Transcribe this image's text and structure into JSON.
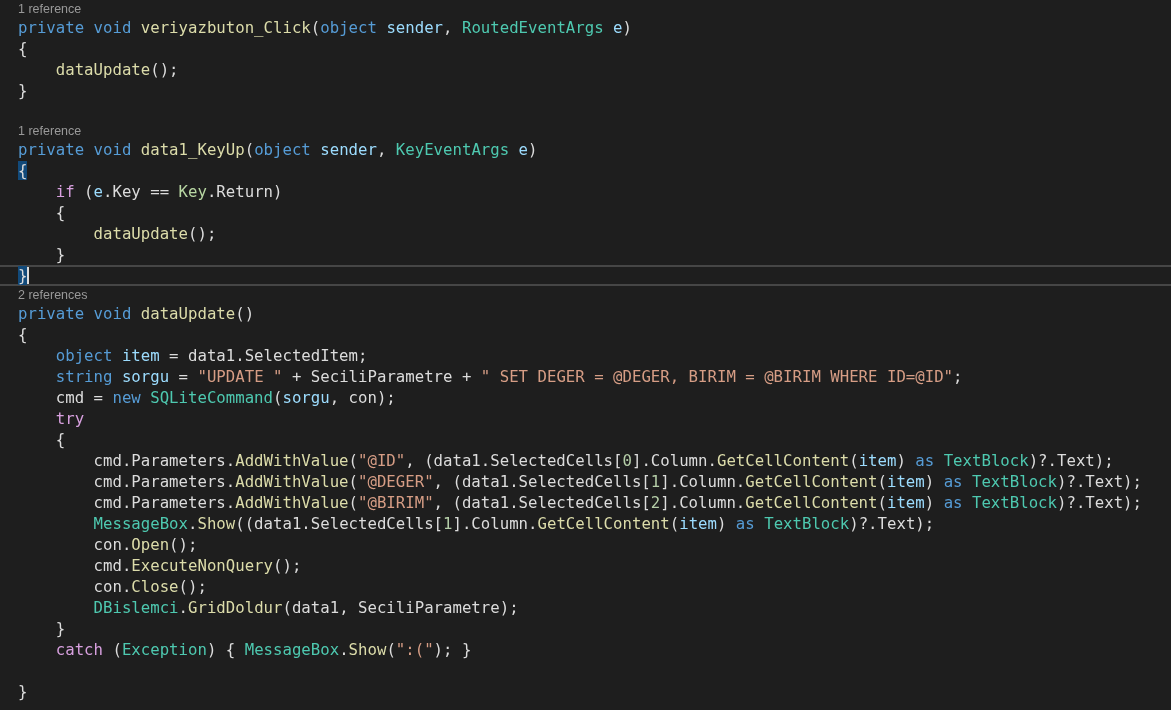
{
  "editor": {
    "lines": [
      {
        "kind": "lens",
        "text": "1 reference"
      },
      {
        "kind": "code",
        "tokens": [
          {
            "text": "private void ",
            "kind": "keyword"
          },
          {
            "text": "veriyazbuton_Click",
            "kind": "method"
          },
          {
            "text": "(",
            "kind": "plain"
          },
          {
            "text": "object ",
            "kind": "keyword"
          },
          {
            "text": "sender",
            "kind": "variable"
          },
          {
            "text": ", ",
            "kind": "plain"
          },
          {
            "text": "RoutedEventArgs ",
            "kind": "type"
          },
          {
            "text": "e",
            "kind": "variable"
          },
          {
            "text": ")",
            "kind": "plain"
          }
        ]
      },
      {
        "kind": "code",
        "tokens": [
          {
            "text": "{",
            "kind": "plain"
          }
        ]
      },
      {
        "kind": "code",
        "tokens": [
          {
            "text": "    dataUpdate",
            "kind": "method"
          },
          {
            "text": "();",
            "kind": "plain"
          }
        ]
      },
      {
        "kind": "code",
        "tokens": [
          {
            "text": "}",
            "kind": "plain"
          }
        ]
      },
      {
        "kind": "blank"
      },
      {
        "kind": "lens",
        "text": "1 reference"
      },
      {
        "kind": "code",
        "tokens": [
          {
            "text": "private void ",
            "kind": "keyword"
          },
          {
            "text": "data1_KeyUp",
            "kind": "method"
          },
          {
            "text": "(",
            "kind": "plain"
          },
          {
            "text": "object ",
            "kind": "keyword"
          },
          {
            "text": "sender",
            "kind": "variable"
          },
          {
            "text": ", ",
            "kind": "plain"
          },
          {
            "text": "KeyEventArgs ",
            "kind": "type"
          },
          {
            "text": "e",
            "kind": "variable"
          },
          {
            "text": ")",
            "kind": "plain"
          }
        ]
      },
      {
        "kind": "code",
        "tokens": [
          {
            "text": "{",
            "kind": "match"
          }
        ]
      },
      {
        "kind": "code",
        "tokens": [
          {
            "text": "    if",
            "kind": "control"
          },
          {
            "text": " (",
            "kind": "plain"
          },
          {
            "text": "e",
            "kind": "variable"
          },
          {
            "text": ".Key == ",
            "kind": "plain"
          },
          {
            "text": "Key",
            "kind": "enum"
          },
          {
            "text": ".Return)",
            "kind": "plain"
          }
        ]
      },
      {
        "kind": "code",
        "tokens": [
          {
            "text": "    {",
            "kind": "plain"
          }
        ]
      },
      {
        "kind": "code",
        "tokens": [
          {
            "text": "        dataUpdate",
            "kind": "method"
          },
          {
            "text": "();",
            "kind": "plain"
          }
        ]
      },
      {
        "kind": "code",
        "tokens": [
          {
            "text": "    }",
            "kind": "plain"
          }
        ]
      },
      {
        "kind": "current",
        "tokens": [
          {
            "text": "}",
            "kind": "match"
          }
        ]
      },
      {
        "kind": "lens",
        "text": "2 references"
      },
      {
        "kind": "code",
        "tokens": [
          {
            "text": "private void ",
            "kind": "keyword"
          },
          {
            "text": "dataUpdate",
            "kind": "method"
          },
          {
            "text": "()",
            "kind": "plain"
          }
        ]
      },
      {
        "kind": "code",
        "tokens": [
          {
            "text": "{",
            "kind": "plain"
          }
        ]
      },
      {
        "kind": "code",
        "tokens": [
          {
            "text": "    object ",
            "kind": "keyword"
          },
          {
            "text": "item",
            "kind": "variable"
          },
          {
            "text": " = data1.SelectedItem;",
            "kind": "plain"
          }
        ]
      },
      {
        "kind": "code",
        "tokens": [
          {
            "text": "    string ",
            "kind": "keyword"
          },
          {
            "text": "sorgu",
            "kind": "variable"
          },
          {
            "text": " = ",
            "kind": "plain"
          },
          {
            "text": "\"UPDATE \"",
            "kind": "string"
          },
          {
            "text": " + SeciliParametre + ",
            "kind": "plain"
          },
          {
            "text": "\" SET DEGER = @DEGER, BIRIM = @BIRIM WHERE ID=@ID\"",
            "kind": "string"
          },
          {
            "text": ";",
            "kind": "plain"
          }
        ]
      },
      {
        "kind": "code",
        "tokens": [
          {
            "text": "    cmd = ",
            "kind": "plain"
          },
          {
            "text": "new ",
            "kind": "keyword"
          },
          {
            "text": "SQLiteCommand",
            "kind": "type"
          },
          {
            "text": "(",
            "kind": "plain"
          },
          {
            "text": "sorgu",
            "kind": "variable"
          },
          {
            "text": ", con);",
            "kind": "plain"
          }
        ]
      },
      {
        "kind": "code",
        "tokens": [
          {
            "text": "    try",
            "kind": "control"
          }
        ]
      },
      {
        "kind": "code",
        "tokens": [
          {
            "text": "    {",
            "kind": "plain"
          }
        ]
      },
      {
        "kind": "code",
        "tokens": [
          {
            "text": "        cmd.Parameters.",
            "kind": "plain"
          },
          {
            "text": "AddWithValue",
            "kind": "method"
          },
          {
            "text": "(",
            "kind": "plain"
          },
          {
            "text": "\"@ID\"",
            "kind": "string"
          },
          {
            "text": ", (data1.SelectedCells[",
            "kind": "plain"
          },
          {
            "text": "0",
            "kind": "number"
          },
          {
            "text": "].Column.",
            "kind": "plain"
          },
          {
            "text": "GetCellContent",
            "kind": "method"
          },
          {
            "text": "(",
            "kind": "plain"
          },
          {
            "text": "item",
            "kind": "variable"
          },
          {
            "text": ") ",
            "kind": "plain"
          },
          {
            "text": "as ",
            "kind": "keyword"
          },
          {
            "text": "TextBlock",
            "kind": "type"
          },
          {
            "text": ")?.Text);",
            "kind": "plain"
          }
        ]
      },
      {
        "kind": "code",
        "tokens": [
          {
            "text": "        cmd.Parameters.",
            "kind": "plain"
          },
          {
            "text": "AddWithValue",
            "kind": "method"
          },
          {
            "text": "(",
            "kind": "plain"
          },
          {
            "text": "\"@DEGER\"",
            "kind": "string"
          },
          {
            "text": ", (data1.SelectedCells[",
            "kind": "plain"
          },
          {
            "text": "1",
            "kind": "number"
          },
          {
            "text": "].Column.",
            "kind": "plain"
          },
          {
            "text": "GetCellContent",
            "kind": "method"
          },
          {
            "text": "(",
            "kind": "plain"
          },
          {
            "text": "item",
            "kind": "variable"
          },
          {
            "text": ") ",
            "kind": "plain"
          },
          {
            "text": "as ",
            "kind": "keyword"
          },
          {
            "text": "TextBlock",
            "kind": "type"
          },
          {
            "text": ")?.Text);",
            "kind": "plain"
          }
        ]
      },
      {
        "kind": "code",
        "tokens": [
          {
            "text": "        cmd.Parameters.",
            "kind": "plain"
          },
          {
            "text": "AddWithValue",
            "kind": "method"
          },
          {
            "text": "(",
            "kind": "plain"
          },
          {
            "text": "\"@BIRIM\"",
            "kind": "string"
          },
          {
            "text": ", (data1.SelectedCells[",
            "kind": "plain"
          },
          {
            "text": "2",
            "kind": "number"
          },
          {
            "text": "].Column.",
            "kind": "plain"
          },
          {
            "text": "GetCellContent",
            "kind": "method"
          },
          {
            "text": "(",
            "kind": "plain"
          },
          {
            "text": "item",
            "kind": "variable"
          },
          {
            "text": ") ",
            "kind": "plain"
          },
          {
            "text": "as ",
            "kind": "keyword"
          },
          {
            "text": "TextBlock",
            "kind": "type"
          },
          {
            "text": ")?.Text);",
            "kind": "plain"
          }
        ]
      },
      {
        "kind": "code",
        "tokens": [
          {
            "text": "        MessageBox",
            "kind": "type"
          },
          {
            "text": ".",
            "kind": "plain"
          },
          {
            "text": "Show",
            "kind": "method"
          },
          {
            "text": "((data1.SelectedCells[",
            "kind": "plain"
          },
          {
            "text": "1",
            "kind": "number"
          },
          {
            "text": "].Column.",
            "kind": "plain"
          },
          {
            "text": "GetCellContent",
            "kind": "method"
          },
          {
            "text": "(",
            "kind": "plain"
          },
          {
            "text": "item",
            "kind": "variable"
          },
          {
            "text": ") ",
            "kind": "plain"
          },
          {
            "text": "as ",
            "kind": "keyword"
          },
          {
            "text": "TextBlock",
            "kind": "type"
          },
          {
            "text": ")?.Text);",
            "kind": "plain"
          }
        ]
      },
      {
        "kind": "code",
        "tokens": [
          {
            "text": "        con.",
            "kind": "plain"
          },
          {
            "text": "Open",
            "kind": "method"
          },
          {
            "text": "();",
            "kind": "plain"
          }
        ]
      },
      {
        "kind": "code",
        "tokens": [
          {
            "text": "        cmd.",
            "kind": "plain"
          },
          {
            "text": "ExecuteNonQuery",
            "kind": "method"
          },
          {
            "text": "();",
            "kind": "plain"
          }
        ]
      },
      {
        "kind": "code",
        "tokens": [
          {
            "text": "        con.",
            "kind": "plain"
          },
          {
            "text": "Close",
            "kind": "method"
          },
          {
            "text": "();",
            "kind": "plain"
          }
        ]
      },
      {
        "kind": "code",
        "tokens": [
          {
            "text": "        DBislemci",
            "kind": "type"
          },
          {
            "text": ".",
            "kind": "plain"
          },
          {
            "text": "GridDoldur",
            "kind": "method"
          },
          {
            "text": "(data1, SeciliParametre);",
            "kind": "plain"
          }
        ]
      },
      {
        "kind": "code",
        "tokens": [
          {
            "text": "    }",
            "kind": "plain"
          }
        ]
      },
      {
        "kind": "code",
        "tokens": [
          {
            "text": "    catch",
            "kind": "control"
          },
          {
            "text": " (",
            "kind": "plain"
          },
          {
            "text": "Exception",
            "kind": "type"
          },
          {
            "text": ") { ",
            "kind": "plain"
          },
          {
            "text": "MessageBox",
            "kind": "type"
          },
          {
            "text": ".",
            "kind": "plain"
          },
          {
            "text": "Show",
            "kind": "method"
          },
          {
            "text": "(",
            "kind": "plain"
          },
          {
            "text": "\":(\"",
            "kind": "string"
          },
          {
            "text": "); }",
            "kind": "plain"
          }
        ]
      },
      {
        "kind": "blank"
      },
      {
        "kind": "code",
        "tokens": [
          {
            "text": "}",
            "kind": "plain"
          }
        ]
      }
    ]
  }
}
